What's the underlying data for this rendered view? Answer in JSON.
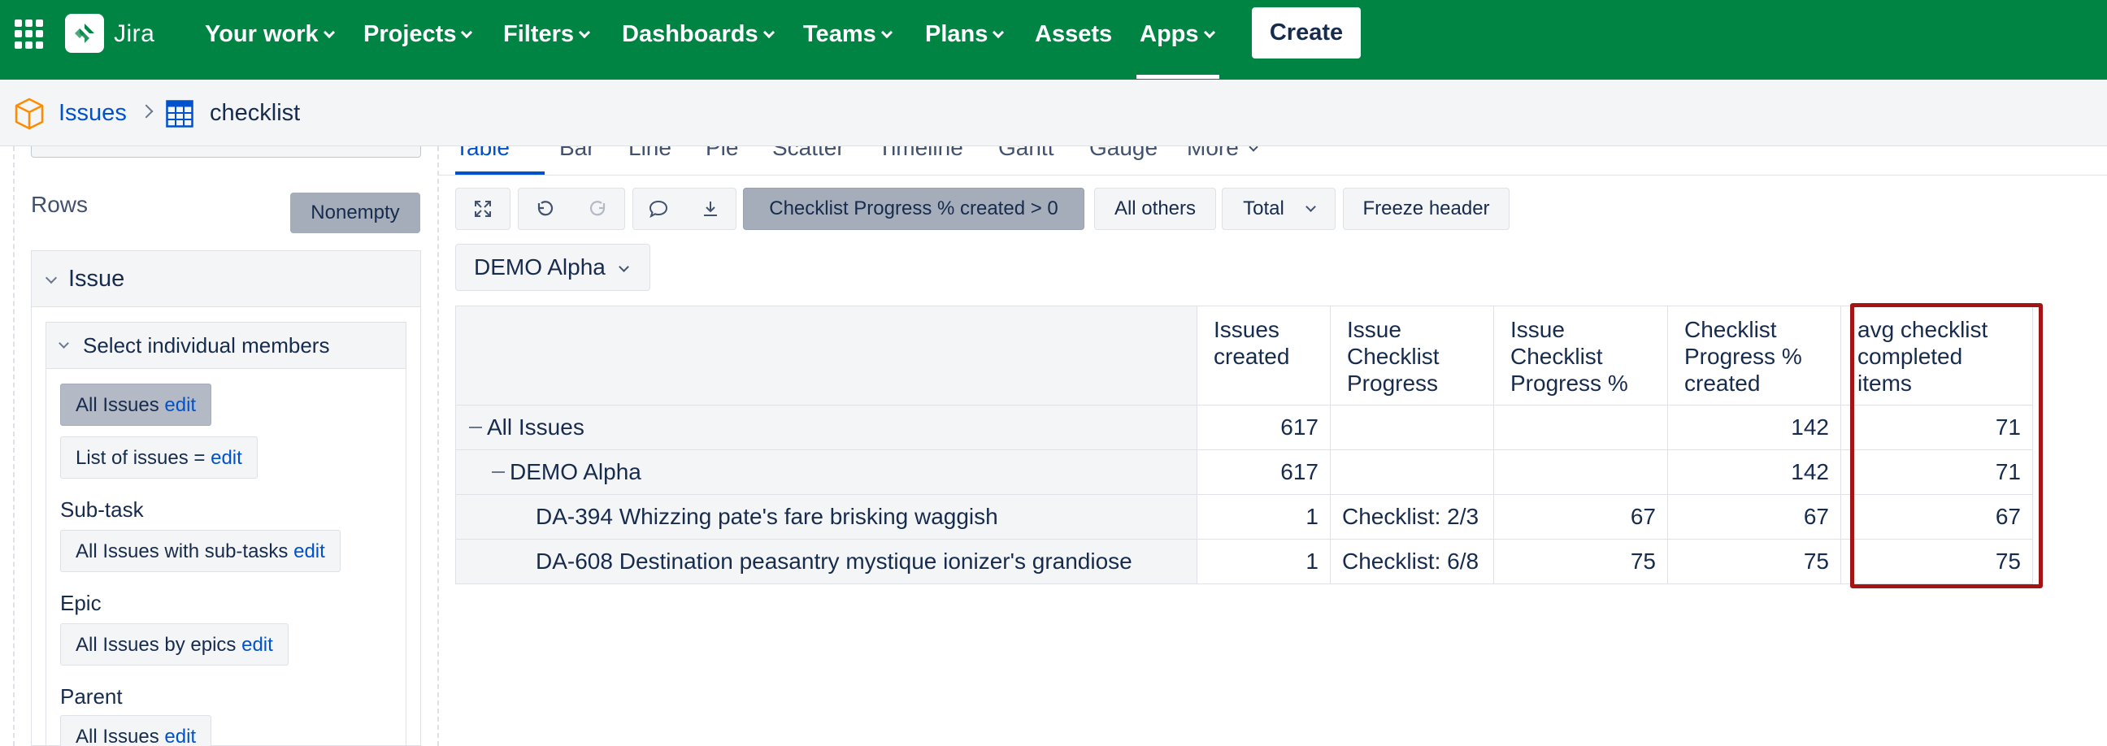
{
  "topnav": {
    "logo_text": "Jira",
    "items": [
      {
        "label": "Your work",
        "has_chevron": true
      },
      {
        "label": "Projects",
        "has_chevron": true
      },
      {
        "label": "Filters",
        "has_chevron": true
      },
      {
        "label": "Dashboards",
        "has_chevron": true
      },
      {
        "label": "Teams",
        "has_chevron": true
      },
      {
        "label": "Plans",
        "has_chevron": true
      },
      {
        "label": "Assets",
        "has_chevron": false
      },
      {
        "label": "Apps",
        "has_chevron": true
      }
    ],
    "active_item": "Apps",
    "create_label": "Create",
    "bg_color": "#008444"
  },
  "breadcrumb": {
    "parent": "Issues",
    "current": "checklist"
  },
  "left_panel": {
    "rows_label": "Rows",
    "nonempty_label": "Nonempty",
    "dimension_label": "Issue",
    "select_label": "Select individual members",
    "chips": [
      {
        "text": "All Issues",
        "edit": "edit",
        "active": true
      },
      {
        "text": "List of issues =",
        "edit": "edit",
        "active": false
      }
    ],
    "sections": [
      {
        "label": "Sub-task",
        "chip_text": "All Issues with sub-tasks",
        "edit": "edit"
      },
      {
        "label": "Epic",
        "chip_text": "All Issues by epics",
        "edit": "edit"
      },
      {
        "label": "Parent",
        "chip_text": "All Issues",
        "edit": "edit"
      }
    ]
  },
  "chart_tabs": {
    "items": [
      "Table",
      "Bar",
      "Line",
      "Pie",
      "Scatter",
      "Timeline",
      "Gantt",
      "Gauge",
      "More"
    ],
    "active": "Table"
  },
  "toolbar": {
    "filter_label": "Checklist Progress % created > 0",
    "all_others_label": "All others",
    "total_label": "Total",
    "freeze_label": "Freeze header",
    "icons": [
      "expand-icon",
      "undo-icon",
      "redo-icon",
      "comment-icon",
      "download-icon"
    ]
  },
  "page_filter": {
    "value": "DEMO Alpha"
  },
  "report_table": {
    "columns": [
      "Issues created",
      "Issue Checklist Progress",
      "Issue Checklist Progress %",
      "Checklist Progress % created",
      "avg checklist completed items"
    ],
    "rows": [
      {
        "label": "All Issues",
        "level": 0,
        "collapsible": true,
        "cells": [
          "617",
          "",
          "",
          "142",
          "71"
        ]
      },
      {
        "label": "DEMO Alpha",
        "level": 1,
        "collapsible": true,
        "cells": [
          "617",
          "",
          "",
          "142",
          "71"
        ]
      },
      {
        "label": "DA-394 Whizzing pate's fare brisking waggish",
        "level": 2,
        "collapsible": false,
        "cells": [
          "1",
          "Checklist: 2/3",
          "67",
          "67",
          "67"
        ]
      },
      {
        "label": "DA-608 Destination peasantry mystique ionizer's grandiose",
        "level": 2,
        "collapsible": false,
        "cells": [
          "1",
          "Checklist: 6/8",
          "75",
          "75",
          "75"
        ]
      }
    ],
    "highlighted_column": "avg checklist completed items",
    "highlight_color": "#a31515"
  }
}
